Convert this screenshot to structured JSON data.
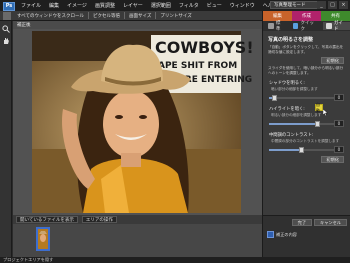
{
  "app": {
    "logo": "Ps",
    "mode_button": "写真整理モード"
  },
  "menu": {
    "items": [
      "ファイル",
      "編集",
      "イメージ",
      "画質調整",
      "レイヤー",
      "選択範囲",
      "フィルタ",
      "ビュー",
      "ウィンドウ",
      "ヘルプ"
    ]
  },
  "window_controls": {
    "minimize": "_",
    "maximize": "□",
    "close": "×"
  },
  "options_bar": {
    "all_windows": "すべてのウィンドウをスクロール",
    "actual_pixels": "ピクセル等倍",
    "fit_screen": "画面サイズ",
    "print_size": "プリントサイズ"
  },
  "document": {
    "tab_label": "補正後"
  },
  "photo": {
    "sign_line1": "COWBOYS!",
    "sign_line2": "APE SHIT FROM",
    "sign_line3": "BEFORE ENTERING"
  },
  "bin": {
    "show_files": "開いているファイルを表示",
    "action": "エリアの操作"
  },
  "status": {
    "text": "プロジェクトエリアを隠す"
  },
  "panel": {
    "workspace_tabs": [
      {
        "label": "編集",
        "color": "#c8632a"
      },
      {
        "label": "作成",
        "color": "#b0226b"
      },
      {
        "label": "共有",
        "color": "#3e8a2c"
      }
    ],
    "mode_tabs": [
      {
        "label": "標準",
        "icon_color": "#9a9a9a"
      },
      {
        "label": "クイック",
        "icon_color": "#5aa0e0"
      },
      {
        "label": "ガイド",
        "icon_color": "#d8d8d8"
      }
    ],
    "title": "写真の明るさを調整",
    "description": "「自動」ボタンをクリックして、写真の露出を適切な値に設定します。",
    "reset_label": "初期化",
    "description2": "スライダを使用して、暗い部分から明るい部分へのトーンを調整します。",
    "shadows_label": "シャドウを明るく:",
    "shadows_hint": "暗い部分の細部を調整します",
    "shadows_value": "0",
    "auto_label": "自動",
    "highlights_label": "ハイライトを暗く:",
    "highlights_hint": "明るい部分の細部を調整します",
    "highlights_value": "0",
    "midtones_label": "中間調のコントラスト:",
    "midtones_hint": "中間調の部分のコントラストを調整します",
    "midtones_value": "0",
    "shadows_level": 0.08,
    "highlights_level": 0.72,
    "midtones_level": 0.48,
    "done_label": "完了",
    "cancel_label": "キャンセル",
    "bottom_item": "補正の内容"
  }
}
